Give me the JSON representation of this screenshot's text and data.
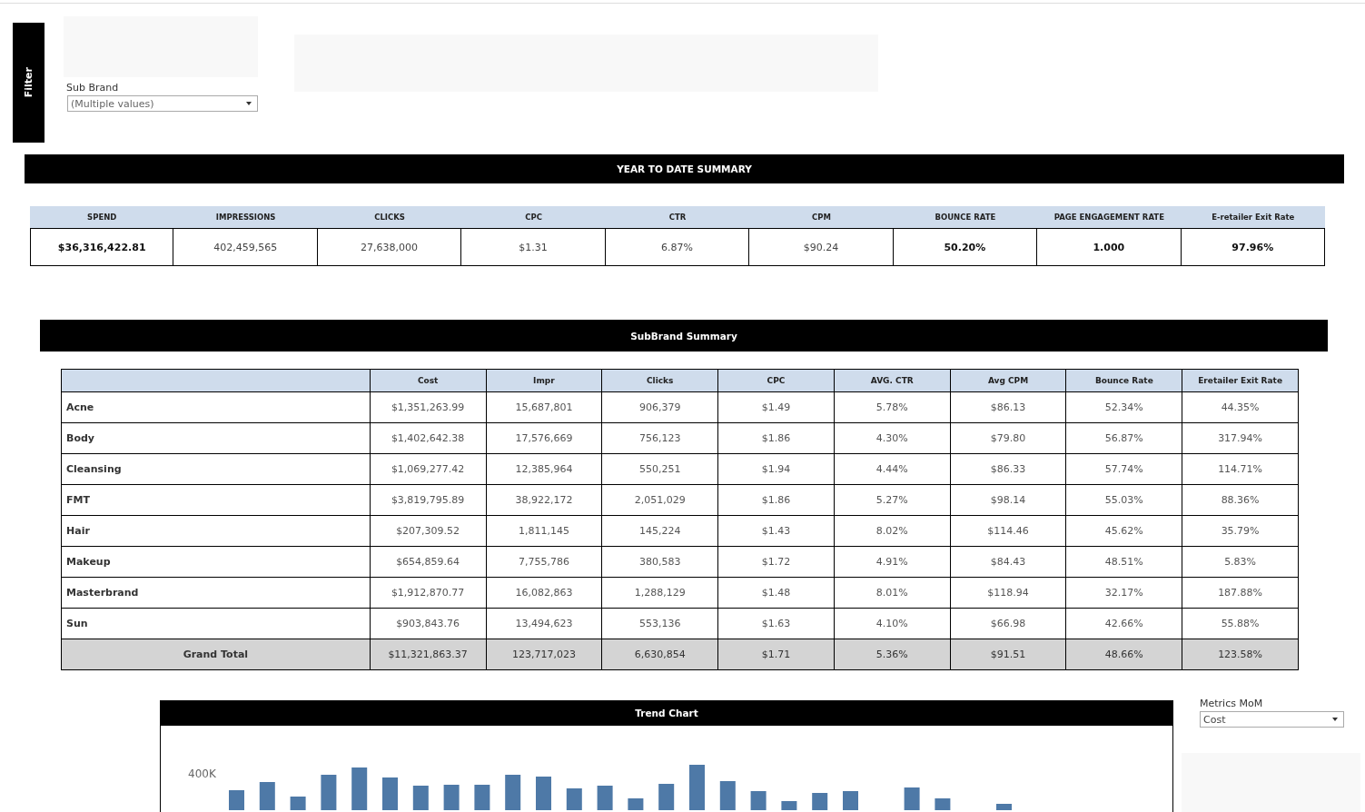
{
  "filter_panel": {
    "label": "Filter"
  },
  "sub_brand_filter": {
    "label": "Sub Brand",
    "value": "(Multiple values)"
  },
  "ytd_summary": {
    "title": "YEAR TO DATE SUMMARY",
    "metrics": [
      {
        "header": "SPEND",
        "value": "$36,316,422.81",
        "bold": true
      },
      {
        "header": "IMPRESSIONS",
        "value": "402,459,565",
        "bold": false
      },
      {
        "header": "CLICKS",
        "value": "27,638,000",
        "bold": false
      },
      {
        "header": "CPC",
        "value": "$1.31",
        "bold": false
      },
      {
        "header": "CTR",
        "value": "6.87%",
        "bold": false
      },
      {
        "header": "CPM",
        "value": "$90.24",
        "bold": false
      },
      {
        "header": "BOUNCE RATE",
        "value": "50.20%",
        "bold": true
      },
      {
        "header": "PAGE ENGAGEMENT RATE",
        "value": "1.000",
        "bold": true
      },
      {
        "header": "E-retailer Exit Rate",
        "value": "97.96%",
        "bold": true
      }
    ]
  },
  "subbrand_summary": {
    "title": "SubBrand  Summary",
    "columns": [
      "Cost",
      "Impr",
      "Clicks",
      "CPC",
      "AVG. CTR",
      "Avg CPM",
      "Bounce Rate",
      "Eretailer Exit Rate"
    ],
    "rows": [
      {
        "name": "Acne",
        "values": [
          "$1,351,263.99",
          "15,687,801",
          "906,379",
          "$1.49",
          "5.78%",
          "$86.13",
          "52.34%",
          "44.35%"
        ]
      },
      {
        "name": "Body",
        "values": [
          "$1,402,642.38",
          "17,576,669",
          "756,123",
          "$1.86",
          "4.30%",
          "$79.80",
          "56.87%",
          "317.94%"
        ]
      },
      {
        "name": "Cleansing",
        "values": [
          "$1,069,277.42",
          "12,385,964",
          "550,251",
          "$1.94",
          "4.44%",
          "$86.33",
          "57.74%",
          "114.71%"
        ]
      },
      {
        "name": "FMT",
        "values": [
          "$3,819,795.89",
          "38,922,172",
          "2,051,029",
          "$1.86",
          "5.27%",
          "$98.14",
          "55.03%",
          "88.36%"
        ]
      },
      {
        "name": "Hair",
        "values": [
          "$207,309.52",
          "1,811,145",
          "145,224",
          "$1.43",
          "8.02%",
          "$114.46",
          "45.62%",
          "35.79%"
        ]
      },
      {
        "name": "Makeup",
        "values": [
          "$654,859.64",
          "7,755,786",
          "380,583",
          "$1.72",
          "4.91%",
          "$84.43",
          "48.51%",
          "5.83%"
        ]
      },
      {
        "name": "Masterbrand",
        "values": [
          "$1,912,870.77",
          "16,082,863",
          "1,288,129",
          "$1.48",
          "8.01%",
          "$118.94",
          "32.17%",
          "187.88%"
        ]
      },
      {
        "name": "Sun",
        "values": [
          "$903,843.76",
          "13,494,623",
          "553,136",
          "$1.63",
          "4.10%",
          "$66.98",
          "42.66%",
          "55.88%"
        ]
      }
    ],
    "total": {
      "label": "Grand Total",
      "values": [
        "$11,321,863.37",
        "123,717,023",
        "6,630,854",
        "$1.71",
        "5.36%",
        "$91.51",
        "48.66%",
        "123.58%"
      ]
    }
  },
  "trend_chart": {
    "title": "Trend Chart",
    "y_tick_label": "400K"
  },
  "metrics_filter": {
    "label": "Metrics MoM",
    "value": "Cost"
  }
}
